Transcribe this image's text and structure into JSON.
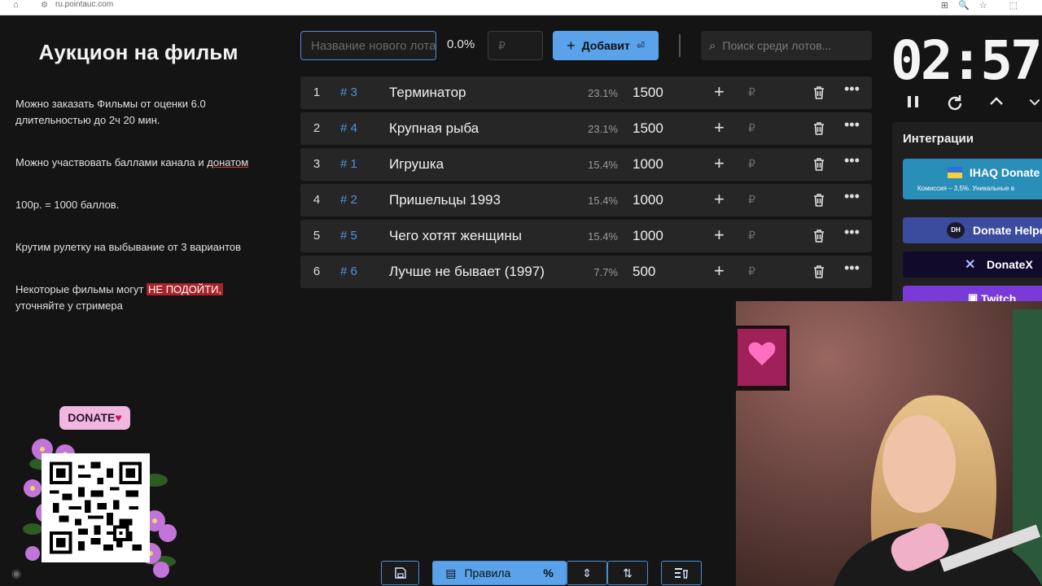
{
  "browser": {
    "url": "ru.pointauc.com"
  },
  "left_panel": {
    "title": "Аукцион на фильм",
    "rules": [
      {
        "text_a": "Можно заказать Фильмы от оценки 6.0",
        "text_b": "длительностью до 2ч 20 мин."
      },
      {
        "text_a": "Можно участвовать баллами канала и ",
        "text_u": "донатом"
      },
      {
        "text_a": "100р. = 1000 баллов."
      },
      {
        "text_a": "Крутим рулетку на выбывание от 3 вариантов"
      },
      {
        "text_a": "Некоторые фильмы могут ",
        "text_hl": "НЕ ПОДОЙТИ,",
        "text_b": "уточняйте у стримера"
      }
    ],
    "donate_badge": "DONATE"
  },
  "toolbar": {
    "new_lot_placeholder": "Название нового лота",
    "percent": "0.0%",
    "amount_placeholder": "₽",
    "add_label": "Добавит",
    "search_placeholder": "Поиск среди лотов..."
  },
  "lots": [
    {
      "num": "1",
      "id": "# 3",
      "name": "Терминатор",
      "percent": "23.1%",
      "amount": "1500"
    },
    {
      "num": "2",
      "id": "# 4",
      "name": "Крупная рыба",
      "percent": "23.1%",
      "amount": "1500"
    },
    {
      "num": "3",
      "id": "# 1",
      "name": "Игрушка",
      "percent": "15.4%",
      "amount": "1000"
    },
    {
      "num": "4",
      "id": "# 2",
      "name": "Пришельцы 1993",
      "percent": "15.4%",
      "amount": "1000"
    },
    {
      "num": "5",
      "id": "# 5",
      "name": "Чего хотят женщины",
      "percent": "15.4%",
      "amount": "1000"
    },
    {
      "num": "6",
      "id": "# 6",
      "name": "Лучше не бывает (1997)",
      "percent": "7.7%",
      "amount": "500"
    }
  ],
  "lot_currency": "₽",
  "timer": {
    "value": "02:57:"
  },
  "integrations": {
    "title": "Интеграции",
    "items": [
      {
        "name": "IHAQ Donate",
        "subtitle": "Комиссия – 3,5%. Уникальные в"
      },
      {
        "name": "Donate Helpe",
        "logo": "DH"
      },
      {
        "name": "DonateX"
      },
      {
        "name": "Twitch"
      }
    ]
  },
  "bottom_toolbar": {
    "rules_label": "Правила"
  },
  "colors": {
    "accent": "#5aa2ea",
    "id_blue": "#4c93e0",
    "row_bg": "#262626",
    "page_bg": "#141414"
  }
}
